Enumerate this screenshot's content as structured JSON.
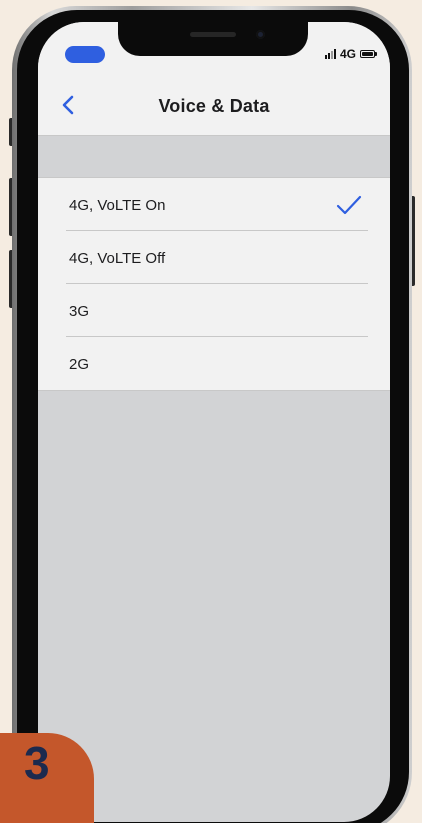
{
  "status_bar": {
    "network": "4G"
  },
  "nav": {
    "title": "Voice & Data",
    "back_icon": "chevron-left-icon"
  },
  "options": [
    {
      "label": "4G, VoLTE On",
      "selected": true
    },
    {
      "label": "4G, VoLTE Off",
      "selected": false
    },
    {
      "label": "3G",
      "selected": false
    },
    {
      "label": "2G",
      "selected": false
    }
  ],
  "step_badge": {
    "number": "3"
  },
  "colors": {
    "accent": "#2f5fe0",
    "background": "#f5ece1",
    "badge": "#c4572b",
    "badge_text": "#1c2a4e",
    "screen_bg": "#d2d3d5",
    "list_bg": "#f2f2f2"
  }
}
